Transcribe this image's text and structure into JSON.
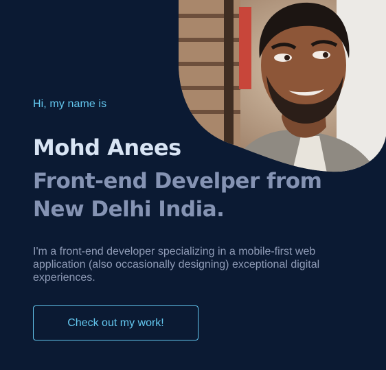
{
  "hero": {
    "greeting": "Hi, my name is",
    "name": "Mohd Anees",
    "headline": "Front-end Develper from\nNew Delhi  India.",
    "intro": "I'm a front-end developer specializing in a mobile-first web application (also occasionally designing) exceptional digital experiences.",
    "cta_label": "Check out my work!"
  },
  "colors": {
    "background": "#0b1a33",
    "accent": "#64c8f0",
    "name": "#d8e4f4",
    "headline": "#8593b3",
    "body_text": "#8f9bb6"
  },
  "portrait": {
    "icon": "profile-photo"
  }
}
